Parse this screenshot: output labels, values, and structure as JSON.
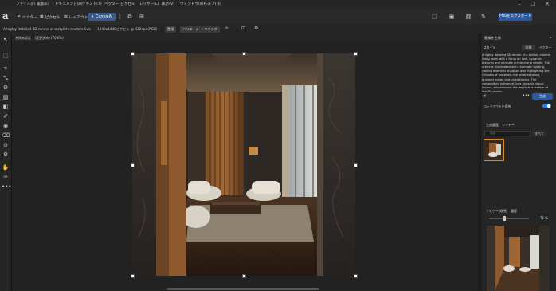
{
  "menu": [
    "ファイル(F)",
    "編集(E)",
    "ドキュメント(D)",
    "テキスト(T)",
    "ベクター",
    "ピクセル",
    "レイヤー(L)",
    "表示(V)",
    "ウィンドウ(W)",
    "ヘルプ(H)"
  ],
  "toolbar": {
    "vector": "ベクター",
    "pixel": "ピクセル",
    "layout": "レイアウト",
    "canva_ai": "Canva AI",
    "export": "PNGをエクスポート"
  },
  "context": {
    "prompt_snippet": "A highly detailed 3D render of a stylish, modern living...",
    "size": "1440x1440ピクセル @ 432dpi (RGB)",
    "btn_edit": "置換",
    "btn_variant": "バリエーション",
    "btn_trim": "トリミング"
  },
  "document": {
    "tab": "名称未設定 * (変更済み) (70.6%)"
  },
  "right_panel": {
    "title": "画像を生成",
    "style_label": "スタイル",
    "tab_image": "画像",
    "tab_vector": "ベクター",
    "prompt": "A highly detailed 3D render of a stylish, modern living room with a focus on lush, dynamic textures and intricate architectural details. The scene is illuminated with cinematic lighting, casting dramatic shadows and highlighting the richness of materials like polished wood, brushed metal, and plush fabrics. The composition is framed for a dynamic visual impact, emphasizing the depth and realism of the 3D render.",
    "generate": "生成",
    "lock_option": "ロックアウトを保持",
    "layers_tab": "生成履歴",
    "layers_tab2": "レイヤー",
    "search_placeholder": "検索",
    "filter": "すべて",
    "navigator_tab": "ナビゲーター",
    "navigator_tab2": "変形",
    "navigator_tab3": "履歴",
    "zoom": "71 %"
  }
}
